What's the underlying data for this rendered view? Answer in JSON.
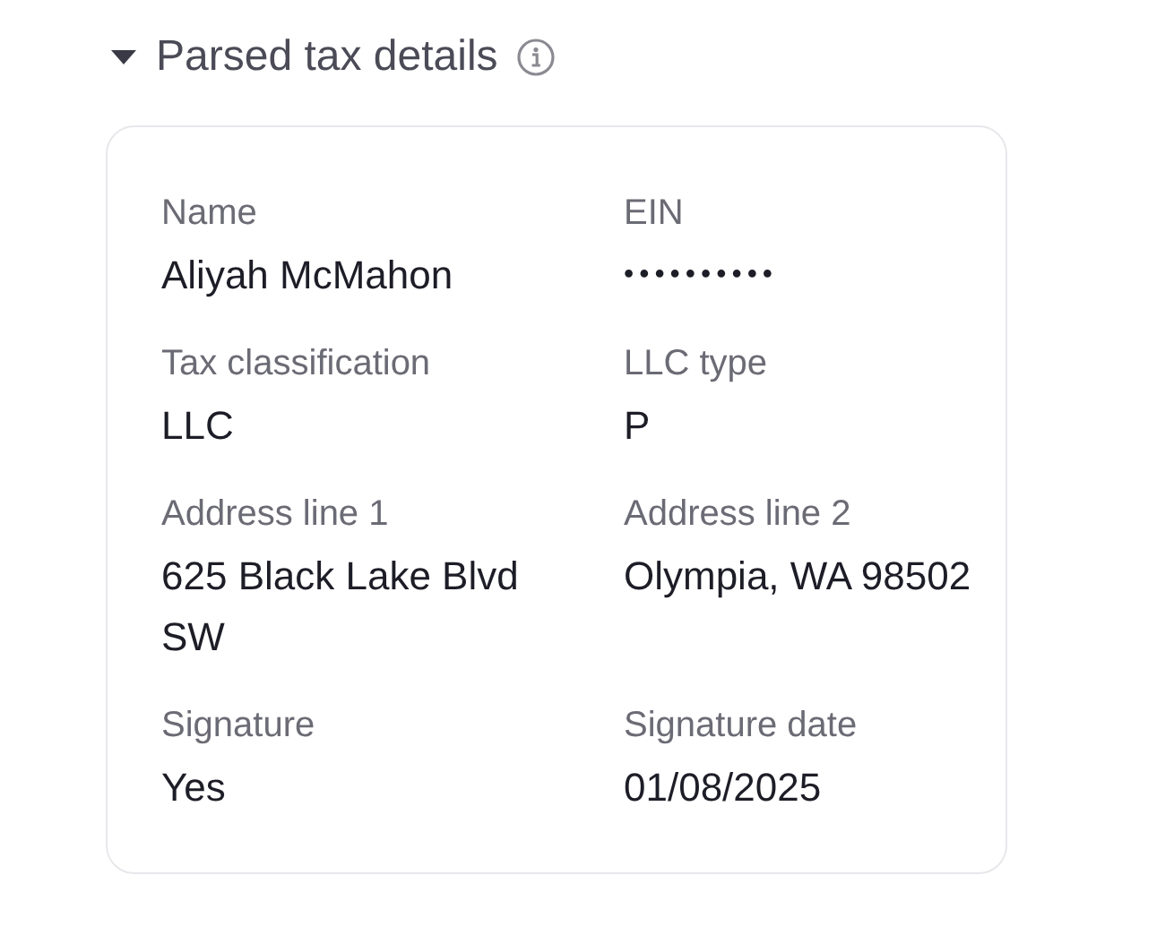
{
  "section": {
    "title": "Parsed tax details",
    "expanded": true
  },
  "fields": [
    {
      "label": "Name",
      "value": "Aliyah McMahon"
    },
    {
      "label": "EIN",
      "value": "••••••••••"
    },
    {
      "label": "Tax classification",
      "value": "LLC"
    },
    {
      "label": "LLC type",
      "value": "P"
    },
    {
      "label": "Address line 1",
      "value": "625 Black Lake Blvd SW"
    },
    {
      "label": "Address line 2",
      "value": "Olympia, WA 98502"
    },
    {
      "label": "Signature",
      "value": "Yes"
    },
    {
      "label": "Signature date",
      "value": "01/08/2025"
    }
  ]
}
